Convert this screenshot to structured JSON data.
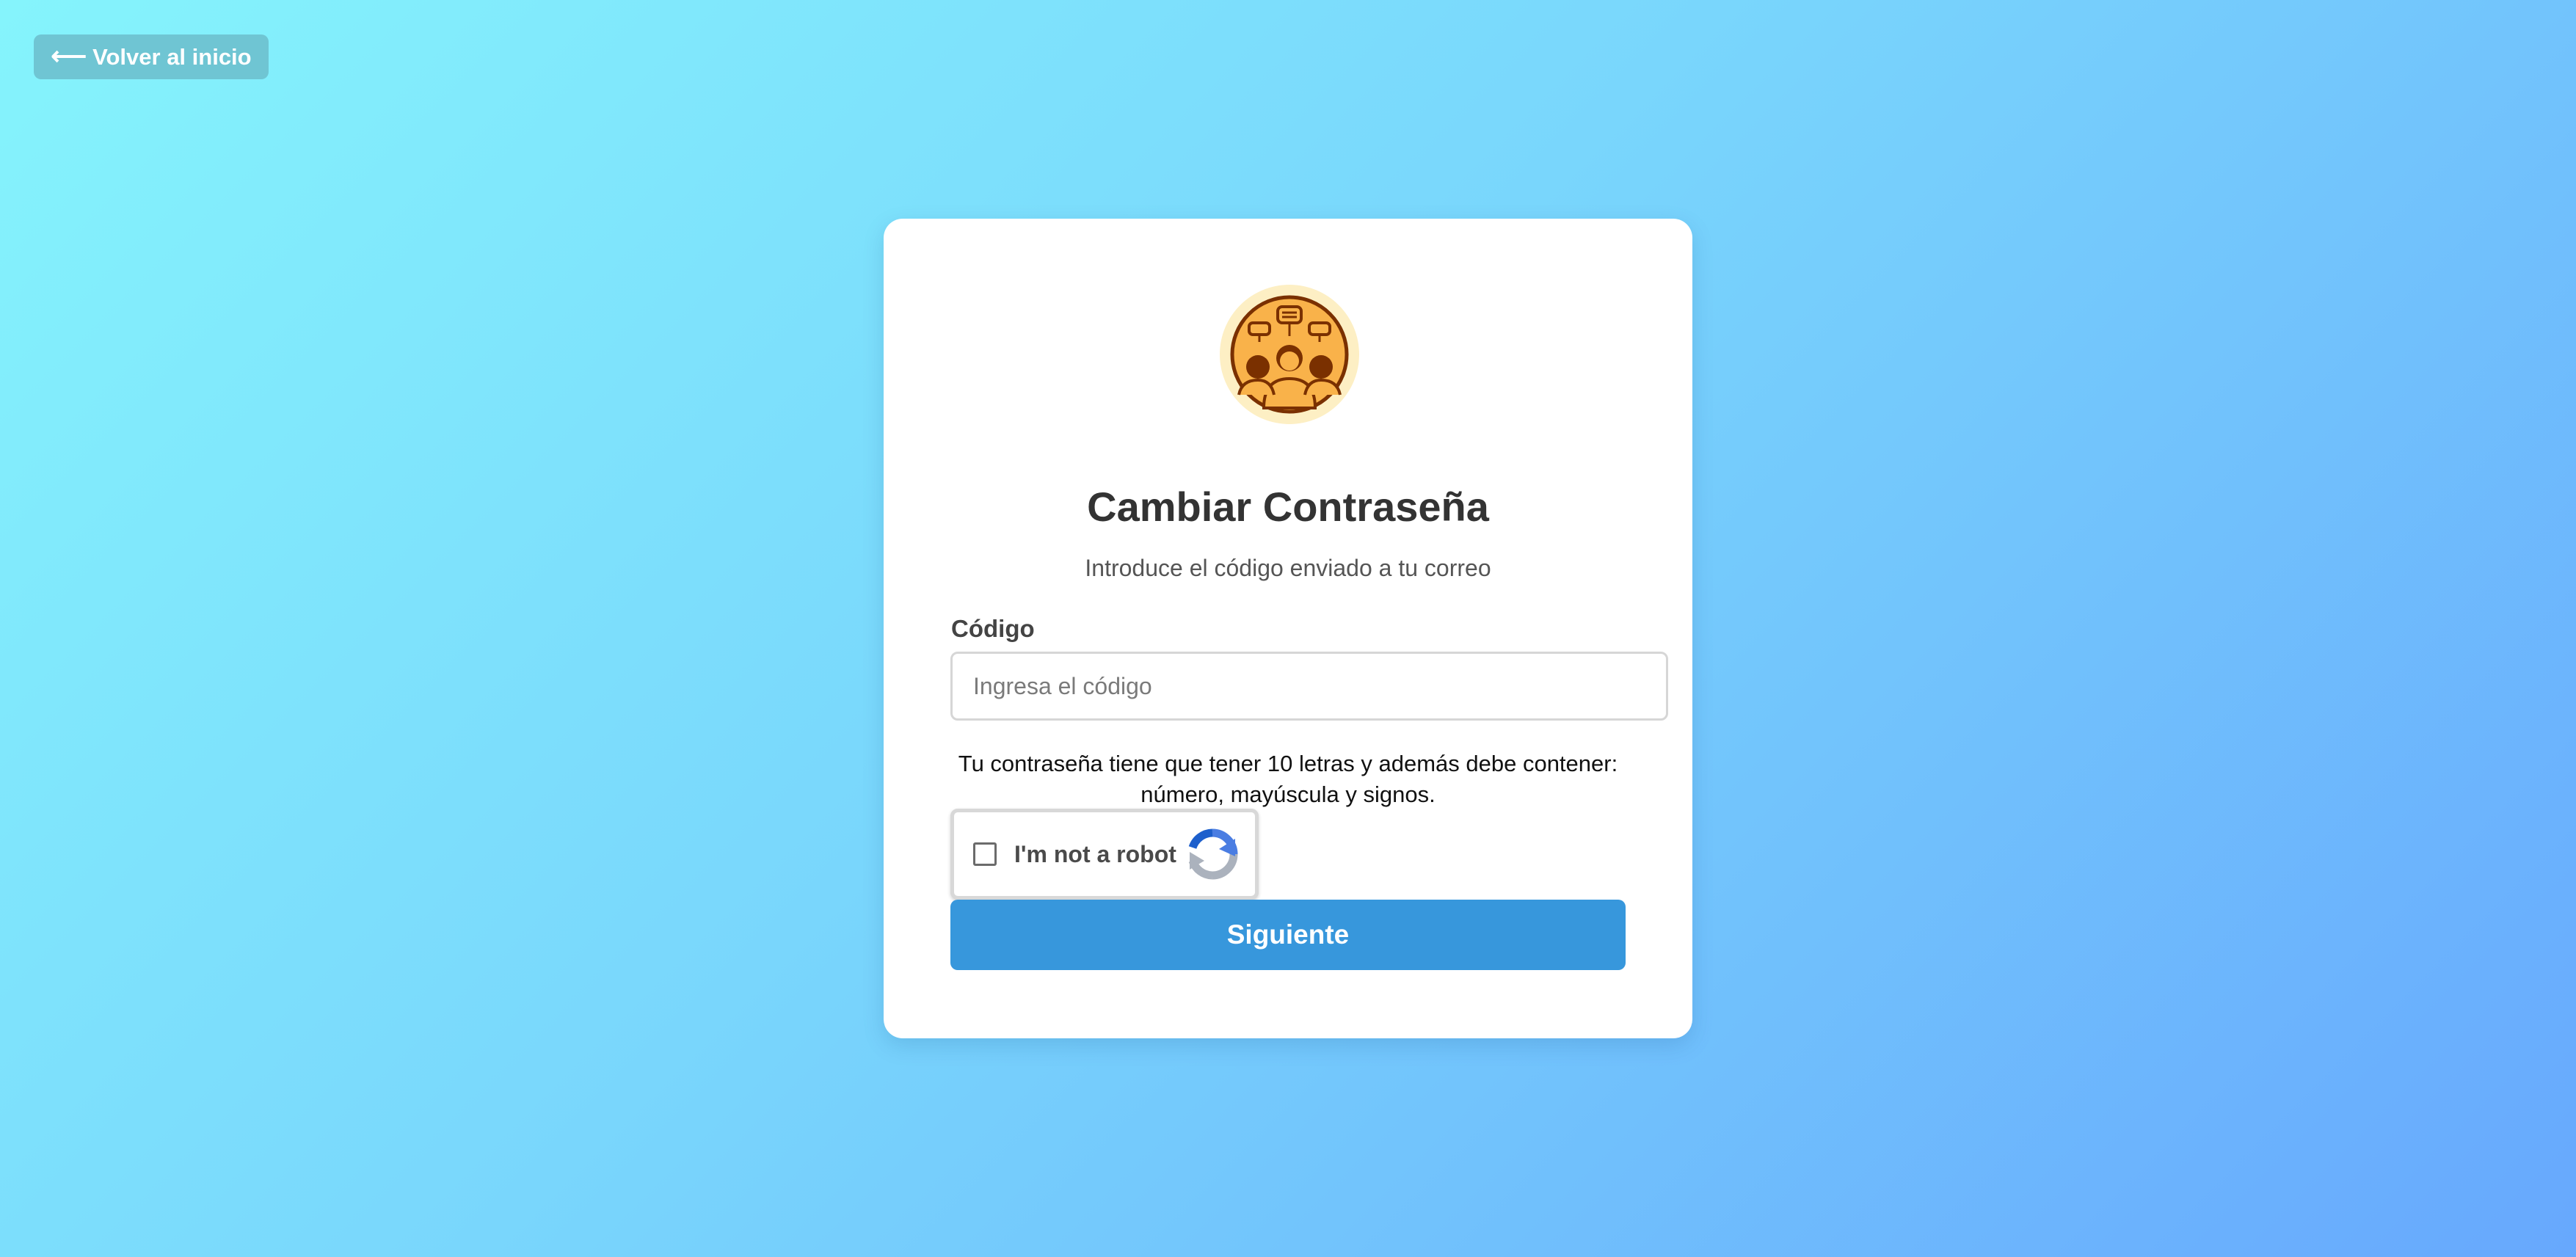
{
  "back_button": {
    "arrow_icon": "left-arrow-icon",
    "label": "Volver al inicio"
  },
  "logo": {
    "icon": "community-people-icon",
    "colors": {
      "outer": "#fdefc4",
      "inner": "#f9b24a",
      "stroke": "#7a3000"
    }
  },
  "form": {
    "title": "Cambiar Contraseña",
    "subtitle": "Introduce el código enviado a tu correo",
    "code_label": "Código",
    "code_placeholder": "Ingresa el código",
    "code_value": "",
    "password_hint": "Tu contraseña tiene que tener 10 letras y además debe contener: número, mayúscula y signos.",
    "captcha": {
      "label": "I'm not a robot",
      "checked": false,
      "icon": "recaptcha-icon"
    },
    "submit_label": "Siguiente"
  },
  "colors": {
    "background_start": "#85f4fc",
    "background_end": "#67a8fd",
    "back_button": "#6fc5d3",
    "primary_button": "#3797dc"
  }
}
